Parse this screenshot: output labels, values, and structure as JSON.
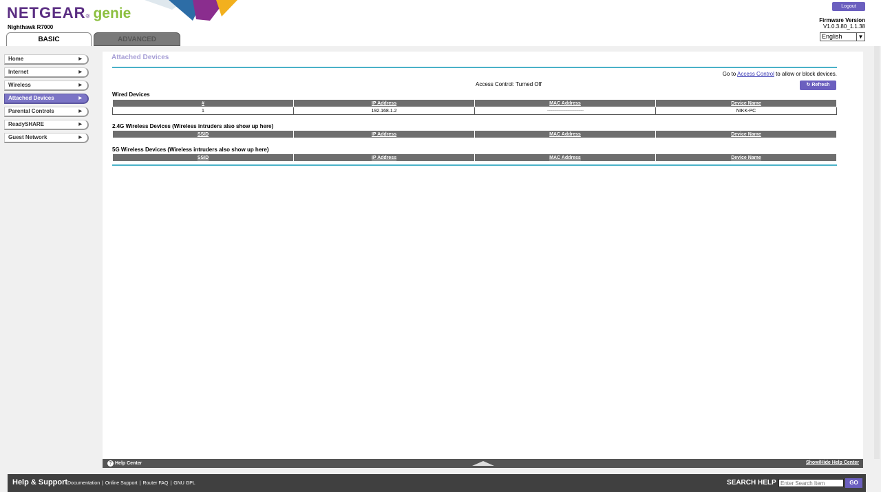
{
  "header": {
    "brand": "NETGEAR",
    "reg": "®",
    "product": "genie",
    "model": "Nighthawk R7000",
    "logout_label": "Logout",
    "firmware_label": "Firmware Version",
    "firmware_value": "V1.0.3.80_1.1.38",
    "language": "English"
  },
  "tabs": {
    "basic": "BASIC",
    "advanced": "ADVANCED"
  },
  "sidebar": {
    "items": [
      {
        "label": "Home"
      },
      {
        "label": "Internet"
      },
      {
        "label": "Wireless"
      },
      {
        "label": "Attached Devices"
      },
      {
        "label": "Parental Controls"
      },
      {
        "label": "ReadySHARE"
      },
      {
        "label": "Guest Network"
      }
    ],
    "active_index": 3
  },
  "main": {
    "title": "Attached Devices",
    "access_prefix": "Go to ",
    "access_link": "Access Control",
    "access_suffix": " to allow or block devices.",
    "access_status": "Access Control: Turned Off",
    "refresh_label": "Refresh",
    "wired": {
      "label": "Wired Devices",
      "columns": [
        "#",
        "IP Address",
        "MAC Address",
        "Device Name"
      ],
      "rows": [
        {
          "num": "1",
          "ip": "192.168.1.2",
          "mac": "~~~~~~~~~~~~~~~~~",
          "name": "NIKK-PC"
        }
      ]
    },
    "wireless24": {
      "label": "2.4G Wireless Devices (Wireless intruders also show up here)",
      "columns": [
        "SSID",
        "IP Address",
        "MAC Address",
        "Device Name"
      ]
    },
    "wireless5": {
      "label": "5G Wireless Devices (Wireless intruders also show up here)",
      "columns": [
        "SSID",
        "IP Address",
        "MAC Address",
        "Device Name"
      ]
    }
  },
  "help_bar": {
    "help_center": "Help Center",
    "toggle": "Show/Hide Help Center"
  },
  "footer": {
    "title": "Help & Support",
    "links": [
      "Documentation",
      "Online Support",
      "Router FAQ",
      "GNU GPL"
    ],
    "search_label": "SEARCH HELP",
    "search_placeholder": "Enter Search Item",
    "go_label": "GO"
  },
  "colors": {
    "brand_purple": "#5a2d82",
    "genie_green": "#8cbf3f",
    "accent_button": "#6b5fbf",
    "active_nav": "#7b74c6",
    "teal_rule": "#4ab1c8"
  }
}
